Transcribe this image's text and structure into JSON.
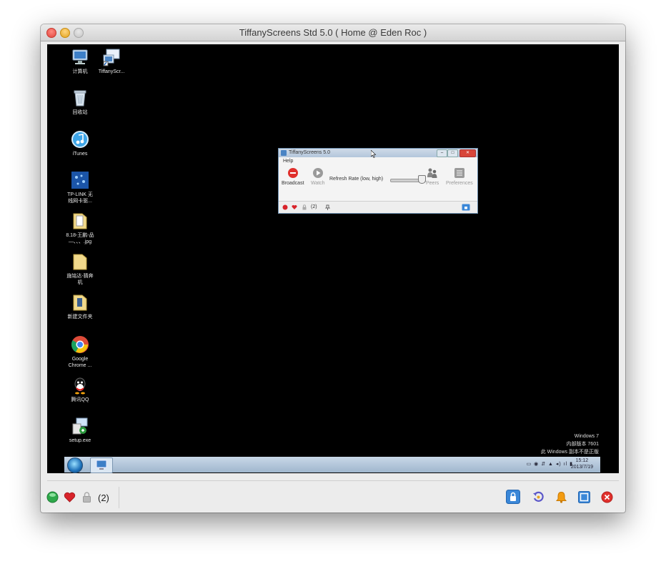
{
  "window": {
    "title": "TiffanyScreens Std 5.0 ( Home @ Eden Roc )"
  },
  "desktop": {
    "icons": [
      {
        "label": "计算机",
        "icon": "computer-icon"
      },
      {
        "label": "TiffanyScr...",
        "icon": "tiffanyscreens-shortcut-icon"
      },
      {
        "label": "回收站",
        "icon": "recycle-bin-icon"
      },
      {
        "label": "iTunes",
        "icon": "itunes-icon"
      },
      {
        "label": "TP-LINK 无\n线网卡驱...",
        "icon": "tp-link-icon"
      },
      {
        "label": "8.18-王鹏-品\n—、、、.jpg",
        "icon": "folder-icon"
      },
      {
        "label": "施铭达-猜奔\n机",
        "icon": "folder-icon"
      },
      {
        "label": "新建文件夹",
        "icon": "folder-icon"
      },
      {
        "label": "Google\nChrome ...",
        "icon": "chrome-icon"
      },
      {
        "label": "腾讯QQ",
        "icon": "qq-icon"
      },
      {
        "label": "setup.exe",
        "icon": "setup-icon"
      }
    ],
    "watermark": [
      "Windows 7",
      "内部版本 7601",
      "此 Windows 副本不是正版"
    ],
    "taskbar": {
      "clock_time": "15:12",
      "clock_date": "2013/7/19"
    }
  },
  "app_window": {
    "title": "TiffanyScreens 5.0",
    "menu": "Help",
    "toolbar": {
      "broadcast": "Broadcast",
      "watch": "Watch",
      "refresh_rate": "Refresh Rate (low, high)",
      "peers": "Peers",
      "preferences": "Preferences"
    },
    "status_count": "(2)"
  },
  "bottom_bar": {
    "peer_count": "(2)",
    "icons_left": [
      "green-status-icon",
      "heart-icon",
      "lock-icon"
    ],
    "icons_right": [
      "lock-screen-icon",
      "refresh-icon",
      "bell-icon",
      "fullscreen-icon",
      "close-session-icon"
    ]
  },
  "colors": {
    "remote_background": "#000000",
    "status_green": "#2ea84a",
    "heart_red": "#d8232a",
    "accent_blue": "#3a87d8",
    "bell_orange": "#f39c12",
    "close_red": "#e0302c"
  }
}
